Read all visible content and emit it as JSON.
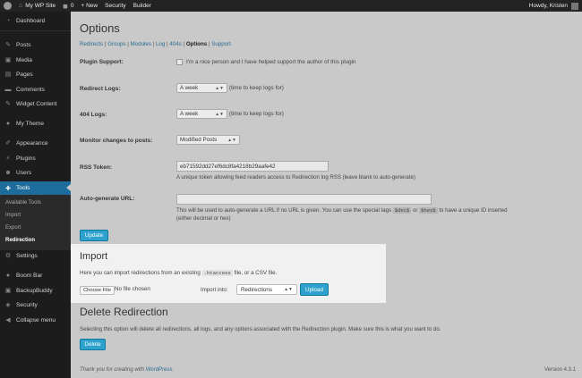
{
  "adminbar": {
    "site_name": "My WP Site",
    "comments_count": "0",
    "new_label": "+ New",
    "security_label": "Security",
    "builder_label": "Builder",
    "greeting": "Howdy, Kristen"
  },
  "sidebar": {
    "items": [
      {
        "icon": "dashboard-icon",
        "label": "Dashboard"
      },
      {
        "icon": "pin-icon",
        "label": "Posts"
      },
      {
        "icon": "media-icon",
        "label": "Media"
      },
      {
        "icon": "page-icon",
        "label": "Pages"
      },
      {
        "icon": "comment-icon",
        "label": "Comments"
      },
      {
        "icon": "pin-icon",
        "label": "Widget Content"
      },
      {
        "icon": "theme-icon",
        "label": "My Theme"
      },
      {
        "icon": "brush-icon",
        "label": "Appearance"
      },
      {
        "icon": "plugin-icon",
        "label": "Plugins"
      },
      {
        "icon": "users-icon",
        "label": "Users"
      },
      {
        "icon": "wrench-icon",
        "label": "Tools"
      },
      {
        "icon": "settings-icon",
        "label": "Settings"
      },
      {
        "icon": "boombar-icon",
        "label": "Boom Bar"
      },
      {
        "icon": "backup-icon",
        "label": "BackupBuddy"
      },
      {
        "icon": "shield-icon",
        "label": "Security"
      },
      {
        "icon": "collapse-icon",
        "label": "Collapse menu"
      }
    ],
    "submenu": [
      "Available Tools",
      "Import",
      "Export",
      "Redirection"
    ]
  },
  "page": {
    "title": "Options",
    "subsub": [
      "Redirects",
      "Groups",
      "Modules",
      "Log",
      "404s",
      "Options",
      "Support"
    ]
  },
  "form": {
    "plugin_support_label": "Plugin Support:",
    "plugin_support_text": "I'm a nice person and I have helped support the author of this plugin",
    "redirect_logs_label": "Redirect Logs:",
    "redirect_logs_value": "A week",
    "redirect_logs_hint": "(time to keep logs for)",
    "logs404_label": "404 Logs:",
    "logs404_value": "A week",
    "logs404_hint": "(time to keep logs for)",
    "monitor_label": "Monitor changes to posts:",
    "monitor_value": "Modified Posts",
    "rss_label": "RSS Token:",
    "rss_value": "eb71592dd27ef6dc8fa4218b29aafe42",
    "rss_desc": "A unique token allowing feed readers access to Redirection log RSS (leave blank to auto-generate)",
    "autogen_label": "Auto-generate URL:",
    "autogen_value": "",
    "autogen_desc_1": "This will be used to auto-generate a URL if no URL is given. You can use the special tags",
    "autogen_tag1": "$dec$",
    "autogen_or": "or",
    "autogen_tag2": "$hex$",
    "autogen_desc_2": "to have a unique ID inserted",
    "autogen_desc_3": "(either decimal or hex)",
    "update_button": "Update"
  },
  "import": {
    "title": "Import",
    "desc_before": "Here you can import redirections from an existing",
    "desc_code": ".htaccess",
    "desc_after": "file, or a CSV file.",
    "choose_file": "Choose File",
    "no_file": "No file chosen",
    "import_into_label": "Import into:",
    "import_into_value": "Redirections",
    "upload_button": "Upload"
  },
  "delete": {
    "title": "Delete Redirection",
    "desc": "Selecting this option will delete all redirections, all logs, and any options associated with the Redirection plugin. Make sure this is what you want to do.",
    "button": "Delete"
  },
  "footer": {
    "thanks_before": "Thank you for creating with",
    "thanks_link": "WordPress",
    "thanks_after": ".",
    "version": "Version 4.3.1"
  }
}
